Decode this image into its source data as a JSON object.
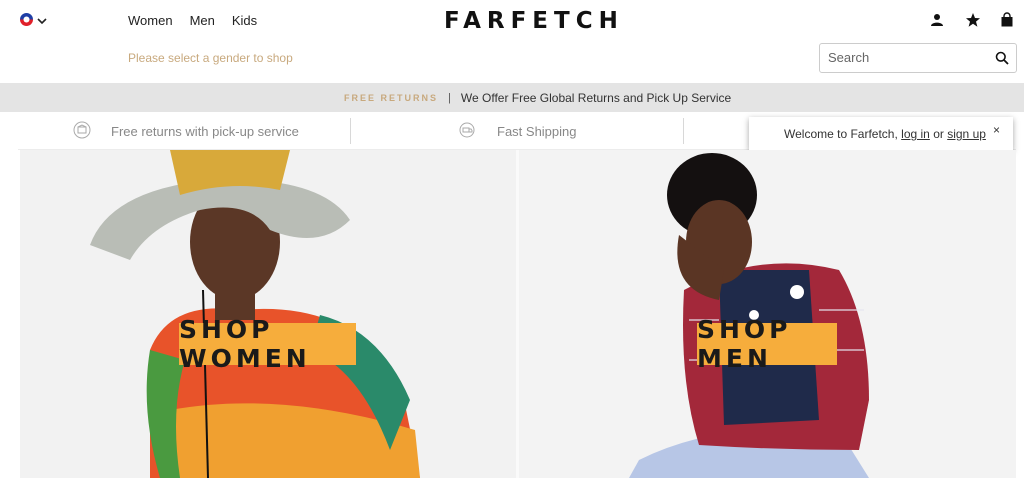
{
  "header": {
    "nav": [
      "Women",
      "Men",
      "Kids"
    ],
    "logo": "FARFETCH",
    "gender_hint": "Please select a gender to shop",
    "search_placeholder": "Search",
    "icons": [
      "account-icon",
      "star-icon",
      "bag-icon"
    ]
  },
  "banner": {
    "tag": "FREE RETURNS",
    "separator": "|",
    "message": "We Offer Free Global Returns and Pick Up Service"
  },
  "services": {
    "items": [
      "Free returns with pick-up service",
      "Fast Shipping"
    ]
  },
  "toast": {
    "prefix": "Welcome to Farfetch,",
    "login": "log in",
    "or": "or",
    "signup": "sign up",
    "close": "×"
  },
  "hero": {
    "women_cta": "SHOP WOMEN",
    "men_cta": "SHOP MEN"
  },
  "colors": {
    "accent_gold": "#c8a97e",
    "cta_orange": "#f6ad3c",
    "banner_bg": "#e4e4e4"
  }
}
